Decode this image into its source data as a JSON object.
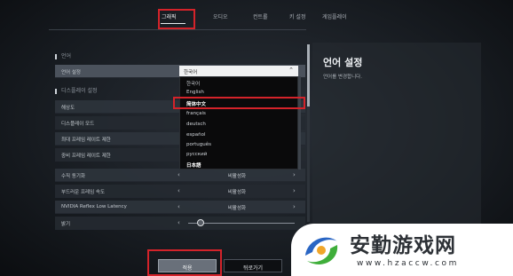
{
  "tabs": [
    {
      "label": "그래픽",
      "active": true
    },
    {
      "label": "오디오",
      "active": false
    },
    {
      "label": "컨트롤",
      "active": false
    },
    {
      "label": "키 설정",
      "active": false
    },
    {
      "label": "게임플레이",
      "active": false
    }
  ],
  "sections": {
    "language": "언어",
    "display": "디스플레이 설정"
  },
  "language_row": {
    "label": "언어 설정",
    "value": "한국어"
  },
  "dropdown_options": [
    {
      "label": "한국어",
      "selected": false
    },
    {
      "label": "English",
      "selected": false
    },
    {
      "label": "简体中文",
      "selected": true
    },
    {
      "label": "français",
      "selected": false
    },
    {
      "label": "deutsch",
      "selected": false
    },
    {
      "label": "español",
      "selected": false
    },
    {
      "label": "português",
      "selected": false
    },
    {
      "label": "русский",
      "selected": false
    },
    {
      "label": "日本語",
      "selected": false
    }
  ],
  "display_rows": [
    {
      "label": "해상도",
      "value": ""
    },
    {
      "label": "디스플레이 모드",
      "value": ""
    },
    {
      "label": "최대 프레임 레이트 제한",
      "value": ""
    },
    {
      "label": "중비 프레임 레이트 제한",
      "value": ""
    },
    {
      "label": "수직 동기화",
      "value": "비활성화"
    },
    {
      "label": "부드러운 프레임 속도",
      "value": "비활성화"
    },
    {
      "label": "NVIDIA Reflex Low Latency",
      "value": "비활성화"
    },
    {
      "label": "밝기",
      "value": ""
    }
  ],
  "slider": {
    "brightness_level": 0.08
  },
  "description": {
    "title": "언어 설정",
    "text": "언어를 변경합니다."
  },
  "buttons": {
    "apply": "적용",
    "back": "뒤로가기"
  },
  "watermark": {
    "title": "安勤游戏网",
    "url": "www.hzaccw.com"
  },
  "colors": {
    "highlight": "#d4232a",
    "background": "#15191e"
  }
}
